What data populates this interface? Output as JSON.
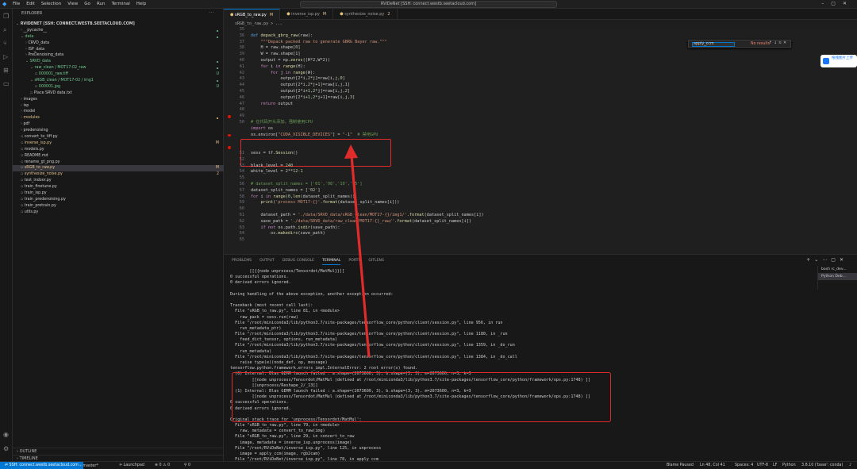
{
  "titlebar": {
    "menus": [
      "File",
      "Edit",
      "Selection",
      "View",
      "Go",
      "Run",
      "Terminal",
      "Help"
    ],
    "command_center": "RViDeNet [SSH: connect.westb.seetacloud.com]"
  },
  "sidebar": {
    "header": "EXPLORER",
    "items": [
      {
        "label": "RVIDENET [SSH: CONNECT.WESTB.SEETACLOUD.COM]",
        "indent": 0,
        "twisty": "v",
        "bold": true
      },
      {
        "label": "__pycache__",
        "indent": 1,
        "twisty": ">",
        "dot": true
      },
      {
        "label": "data",
        "indent": 1,
        "twisty": "v",
        "dot": true,
        "color": "#73c991"
      },
      {
        "label": "CRVD_data",
        "indent": 2,
        "twisty": ">"
      },
      {
        "label": "ISP_data",
        "indent": 2,
        "twisty": ">"
      },
      {
        "label": "PreDenoising_data",
        "indent": 2,
        "twisty": ">"
      },
      {
        "label": "SRVD_data",
        "indent": 2,
        "twisty": "v",
        "dot": true,
        "color": "#73c991"
      },
      {
        "label": "raw_clean / MOT17-02_raw",
        "indent": 3,
        "twisty": "v",
        "dot": true,
        "color": "#73c991"
      },
      {
        "label": "000001_raw.tiff",
        "indent": 4,
        "twisty": "",
        "status": "U",
        "color": "#73c991"
      },
      {
        "label": "sRGB_clean / MOT17-02 / img1",
        "indent": 3,
        "twisty": "v",
        "dot": true,
        "color": "#73c991"
      },
      {
        "label": "000001.jpg",
        "indent": 4,
        "twisty": "",
        "status": "U",
        "color": "#73c991"
      },
      {
        "label": "Place SRVD data.txt",
        "indent": 3,
        "twisty": ""
      },
      {
        "label": "images",
        "indent": 1,
        "twisty": ">"
      },
      {
        "label": "isp",
        "indent": 1,
        "twisty": ">"
      },
      {
        "label": "model",
        "indent": 1,
        "twisty": ">"
      },
      {
        "label": "modules",
        "indent": 1,
        "twisty": ">",
        "dot": true,
        "color": "#e2c08d"
      },
      {
        "label": "pdf",
        "indent": 1,
        "twisty": ">"
      },
      {
        "label": "predenoising",
        "indent": 1,
        "twisty": ">"
      },
      {
        "label": "convert_to_tiff.py",
        "indent": 1,
        "twisty": ""
      },
      {
        "label": "inverse_isp.py",
        "indent": 1,
        "twisty": "",
        "status": "M",
        "color": "#e2c08d"
      },
      {
        "label": "models.py",
        "indent": 1,
        "twisty": ""
      },
      {
        "label": "README.md",
        "indent": 1,
        "twisty": ""
      },
      {
        "label": "rename_gt_png.py",
        "indent": 1,
        "twisty": ""
      },
      {
        "label": "sRGB_to_raw.py",
        "indent": 1,
        "twisty": "",
        "status": "M",
        "color": "#e2c08d",
        "selected": true
      },
      {
        "label": "synthesize_noise.py",
        "indent": 1,
        "twisty": "",
        "status": "2",
        "color": "#e2c08d"
      },
      {
        "label": "test_indoor.py",
        "indent": 1,
        "twisty": ""
      },
      {
        "label": "train_finetune.py",
        "indent": 1,
        "twisty": ""
      },
      {
        "label": "train_isp.py",
        "indent": 1,
        "twisty": ""
      },
      {
        "label": "train_predenoising.py",
        "indent": 1,
        "twisty": ""
      },
      {
        "label": "train_pretrain.py",
        "indent": 1,
        "twisty": ""
      },
      {
        "label": "utils.py",
        "indent": 1,
        "twisty": ""
      }
    ],
    "outline": "OUTLINE",
    "timeline": "TIMELINE"
  },
  "editor": {
    "tabs": [
      {
        "label": "sRGB_to_raw.py",
        "mark": "M",
        "active": true
      },
      {
        "label": "inverse_isp.py",
        "mark": "M",
        "active": false
      },
      {
        "label": "synthesize_noise.py",
        "mark": "2",
        "active": false
      }
    ],
    "breadcrumb": "sRGB_to_raw.py > ...",
    "find": {
      "value": "apply_ccm",
      "result": "No results"
    },
    "upload_label": "拖拽图片上传",
    "lines": [
      {
        "n": "35",
        "t": ""
      },
      {
        "n": "36",
        "t": "def depack_gbrg_raw(raw):"
      },
      {
        "n": "37",
        "t": "    \"\"\"Depack packed raw to generate GBRG Bayer raw.\"\"\""
      },
      {
        "n": "38",
        "t": "    H = raw.shape[0]"
      },
      {
        "n": "39",
        "t": "    W = raw.shape[1]"
      },
      {
        "n": "40",
        "t": "    output = np.zeros((H*2,W*2))"
      },
      {
        "n": "41",
        "t": "    for i in range(H):"
      },
      {
        "n": "42",
        "t": "        for j in range(W):"
      },
      {
        "n": "43",
        "t": "            output[2*i,2*j]=raw[i,j,0]"
      },
      {
        "n": "44",
        "t": "            output[2*i,2*j+1]=raw[i,j,1]"
      },
      {
        "n": "45",
        "t": "            output[2*i+1,2*j]=raw[i,j,2]"
      },
      {
        "n": "46",
        "t": "            output[2*i+1,2*j+1]=raw[i,j,3]"
      },
      {
        "n": "47",
        "t": "    return output"
      },
      {
        "n": "48",
        "t": ""
      },
      {
        "n": "49",
        "t": "",
        "bp": true
      },
      {
        "n": "50",
        "t": "# 在代码开头添加，强制使用CPU"
      },
      {
        "n": "",
        "t": "import os"
      },
      {
        "n": "",
        "t": "os.environ[\"CUDA_VISIBLE_DEVICES\"] = \"-1\"  # 禁用GPU",
        "bp": true
      },
      {
        "n": "",
        "t": ""
      },
      {
        "n": "",
        "t": "",
        "bp": true
      },
      {
        "n": "51",
        "t": "sess = tf.Session()"
      },
      {
        "n": "52",
        "t": ""
      },
      {
        "n": "53",
        "t": "black_level = 240"
      },
      {
        "n": "54",
        "t": "white_level = 2**12-1"
      },
      {
        "n": "55",
        "t": ""
      },
      {
        "n": "56",
        "t": "# dataset_split_names = ['01','08','10','15']"
      },
      {
        "n": "57",
        "t": "dataset_split_names = ['02']"
      },
      {
        "n": "58",
        "t": "for i in range(0,len(dataset_split_names)):"
      },
      {
        "n": "59",
        "t": "    print('process MOT17-{}'.format(dataset_split_names[i]))"
      },
      {
        "n": "60",
        "t": ""
      },
      {
        "n": "61",
        "t": "    dataset_path = './data/SRVD_data/sRGB_clean/MOT17-{}/img1/'.format(dataset_split_names[i])"
      },
      {
        "n": "62",
        "t": "    save_path = './data/SRVD_data/raw_clean/MOT17-{}_raw/'.format(dataset_split_names[i])"
      },
      {
        "n": "63",
        "t": "    if not os.path.isdir(save_path):"
      },
      {
        "n": "64",
        "t": "        os.makedirs(save_path)"
      },
      {
        "n": "65",
        "t": ""
      }
    ]
  },
  "panel": {
    "tabs": [
      "PROBLEMS",
      "OUTPUT",
      "DEBUG CONSOLE",
      "TERMINAL",
      "PORTS",
      "GITLENS"
    ],
    "active_tab": "TERMINAL",
    "terminal_list": [
      "bash  rc_dev...",
      "Python Deb..."
    ],
    "lines": [
      "        [[{{node unprocess/Tensordot/MatMul}}]]",
      "0 successful operations.",
      "0 derived errors ignored.",
      "",
      "During handling of the above exception, another exception occurred:",
      "",
      "Traceback (most recent call last):",
      "  File \"sRGB_to_raw.py\", line 81, in <module>",
      "    raw_pack = sess.run(raw)",
      "  File \"/root/miniconda3/lib/python3.7/site-packages/tensorflow_core/python/client/session.py\", line 956, in run",
      "    run_metadata_ptr)",
      "  File \"/root/miniconda3/lib/python3.7/site-packages/tensorflow_core/python/client/session.py\", line 1180, in _run",
      "    feed_dict_tensor, options, run_metadata)",
      "  File \"/root/miniconda3/lib/python3.7/site-packages/tensorflow_core/python/client/session.py\", line 1359, in _do_run",
      "    run_metadata)",
      "  File \"/root/miniconda3/lib/python3.7/site-packages/tensorflow_core/python/client/session.py\", line 1384, in _do_call",
      "    raise type(e)(node_def, op, message)",
      "tensorflow.python.framework.errors_impl.InternalError: 2 root error(s) found.",
      "  (0) Internal: Blas GEMM launch failed : a.shape=(2073600, 3), b.shape=(3, 3), m=2073600, n=3, k=3",
      "         [[node unprocess/Tensordot/MatMul (defined at /root/miniconda3/lib/python3.7/site-packages/tensorflow_core/python/framework/ops.py:1748) ]]",
      "         [[unprocess/Reshape_2/_13]]",
      "  (1) Internal: Blas GEMM launch failed : a.shape=(2073600, 3), b.shape=(3, 3), m=2073600, n=3, k=3",
      "         [[node unprocess/Tensordot/MatMul (defined at /root/miniconda3/lib/python3.7/site-packages/tensorflow_core/python/framework/ops.py:1748) ]]",
      "0 successful operations.",
      "0 derived errors ignored.",
      "",
      "Original stack trace for 'unprocess/Tensordot/MatMul':",
      "  File \"sRGB_to_raw.py\", line 79, in <module>",
      "    raw, metadata = convert_to_raw(img)",
      "  File \"sRGB_to_raw.py\", line 29, in convert_to_raw",
      "    image, metadata = inverse_isp.unprocess(image)",
      "  File \"/root/RViDeNet/inverse_isp.py\", line 125, in unprocess",
      "    image = apply_ccm(image, rgb2cam)",
      "  File \"/root/RViDeNet/inverse_isp.py\", line 78, in apply_ccm",
      "    image = tf.tensordot(image, ccm, axes=[[-1], [-1]])",
      "  File \"/root/miniconda3/lib/python3.7/site-packages/tensorflow_core/python/ops/math_ops.py\", line 4071, in tensordot"
    ]
  },
  "statusbar": {
    "remote": "SSH: connect.westb.seetacloud.com",
    "branch": "master*",
    "launchpad": "Launchpad",
    "problems": "⊗ 0 ⚠ 0",
    "ports": "0",
    "blame": "Blame Paused",
    "position": "Ln 48, Col 41",
    "spaces": "Spaces: 4",
    "encoding": "UTF-8",
    "eol": "LF",
    "language": "Python",
    "interpreter": "3.8.10 ('base': conda)"
  }
}
